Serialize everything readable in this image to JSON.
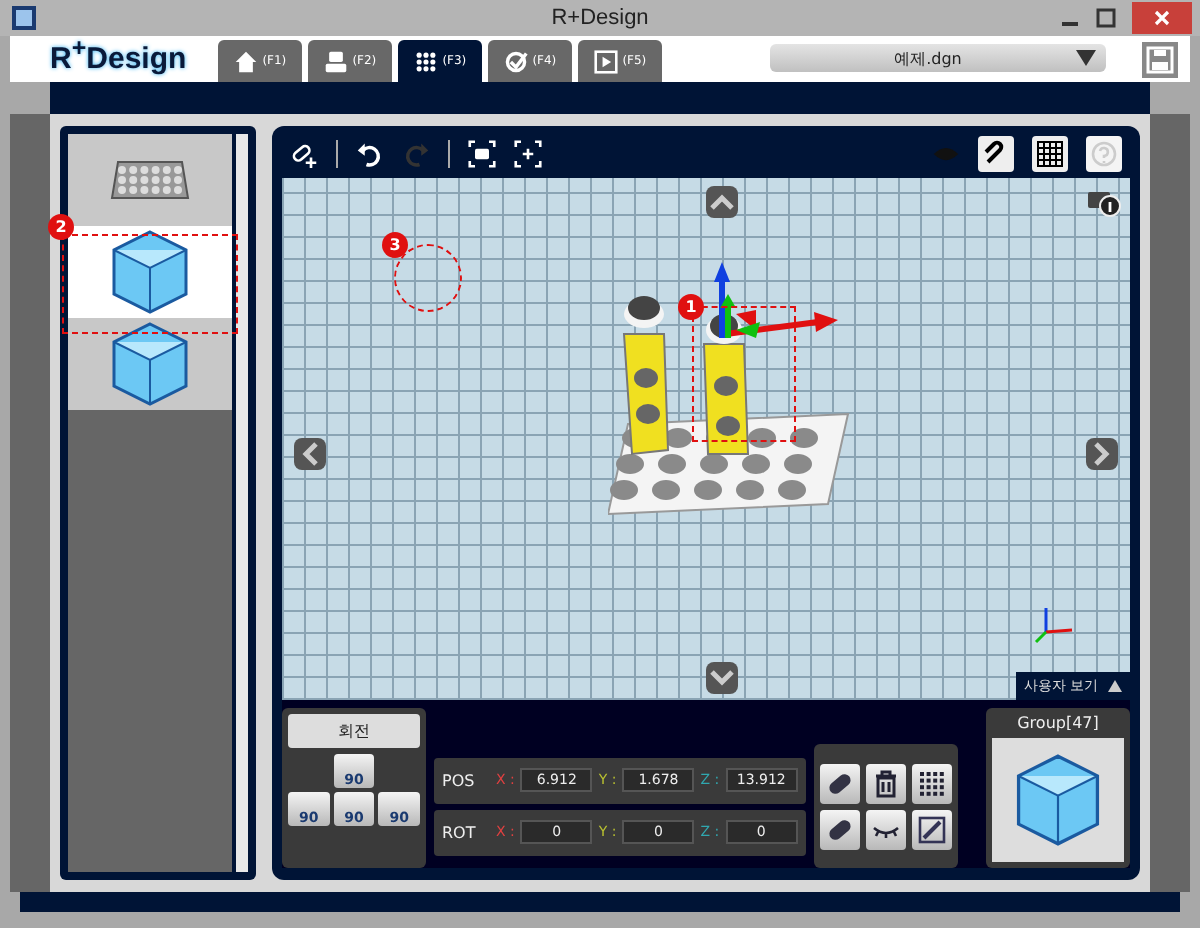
{
  "window": {
    "title": "R+Design"
  },
  "logo": {
    "text": "R$^{+}$Design"
  },
  "tabs": [
    {
      "label": "(F1)",
      "selected": false
    },
    {
      "label": "(F2)",
      "selected": false
    },
    {
      "label": "(F3)",
      "selected": true
    },
    {
      "label": "(F4)",
      "selected": false
    },
    {
      "label": "(F5)",
      "selected": false
    }
  ],
  "file_dropdown": {
    "value": "예제.dgn"
  },
  "parts_list": {
    "annotation": "2",
    "items": [
      {
        "kind": "plate",
        "selected": false
      },
      {
        "kind": "cube",
        "selected": true
      },
      {
        "kind": "cube",
        "selected": false
      }
    ]
  },
  "viewport": {
    "annotations": [
      "1",
      "3"
    ],
    "view_label": "사용자 보기"
  },
  "rotation": {
    "title": "회전",
    "buttons": [
      "90",
      "90",
      "90",
      "90"
    ]
  },
  "transform_rows": [
    {
      "label": "POS",
      "fields": [
        {
          "axis": "X :",
          "value": "6.912"
        },
        {
          "axis": "Y :",
          "value": "1.678"
        },
        {
          "axis": "Z :",
          "value": "13.912"
        }
      ]
    },
    {
      "label": "ROT",
      "fields": [
        {
          "axis": "X :",
          "value": "0"
        },
        {
          "axis": "Y :",
          "value": "0"
        },
        {
          "axis": "Z :",
          "value": "0"
        }
      ]
    }
  ],
  "group": {
    "title": "Group[47]"
  }
}
